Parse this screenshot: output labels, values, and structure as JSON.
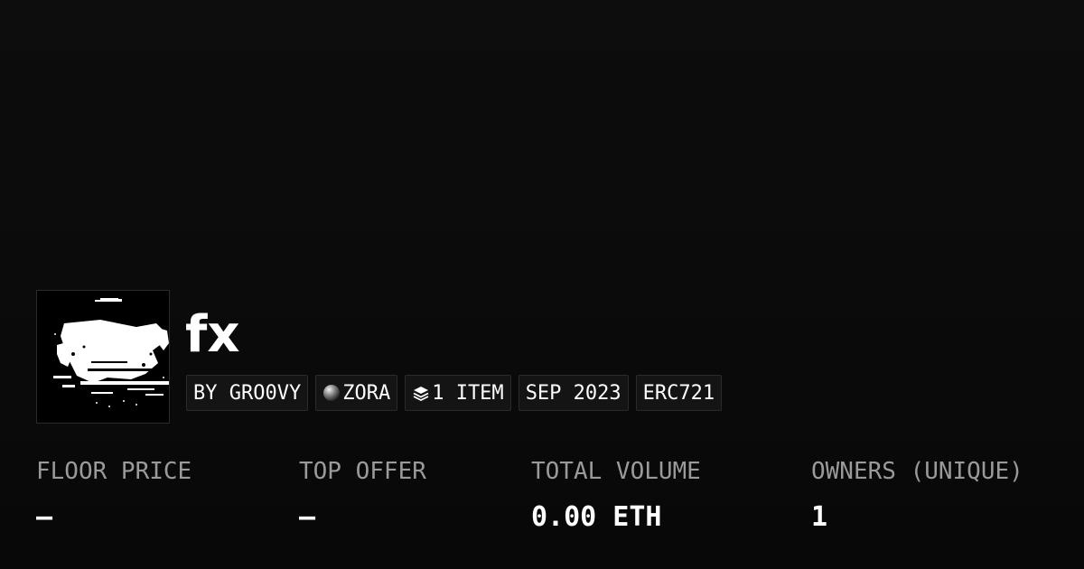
{
  "collection": {
    "title": "fx",
    "thumbnail_icon": "collection-artwork-thumbnail"
  },
  "tags": {
    "creator": "BY GRO0VY",
    "chain": "ZORA",
    "chain_icon": "zora-orb-icon",
    "items": "1 ITEM",
    "items_icon": "layers-icon",
    "date": "SEP 2023",
    "standard": "ERC721"
  },
  "stats": {
    "floor_price": {
      "label": "FLOOR PRICE",
      "value": "—"
    },
    "top_offer": {
      "label": "TOP OFFER",
      "value": "—"
    },
    "total_volume": {
      "label": "TOTAL VOLUME",
      "value": "0.00 ETH"
    },
    "owners": {
      "label": "OWNERS (UNIQUE)",
      "value": "1"
    }
  },
  "colors": {
    "background": "#0b0b0b",
    "text": "#ffffff",
    "label": "#9a9a9a",
    "tag_bg": "#141414",
    "tag_border": "#2b2b2b"
  }
}
